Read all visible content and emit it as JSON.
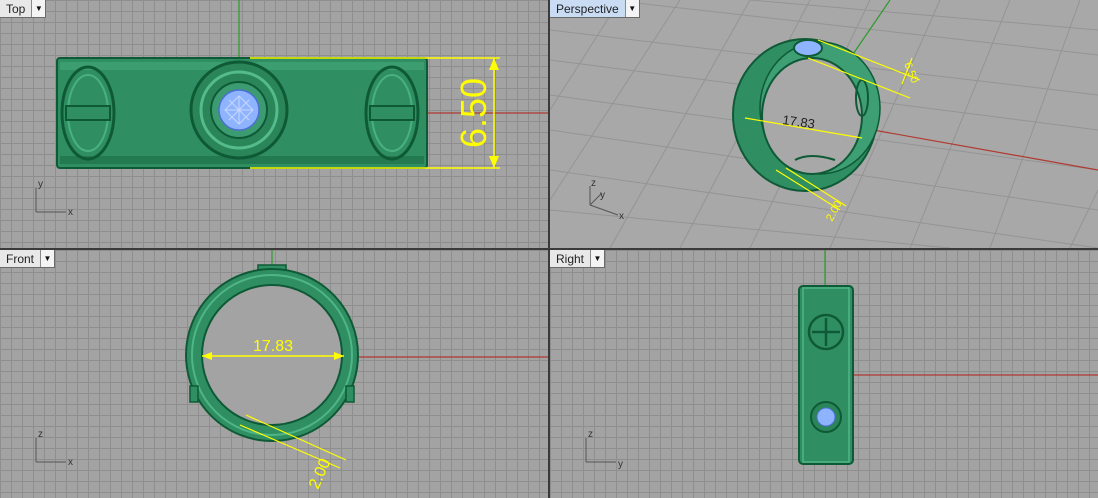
{
  "viewports": {
    "top": {
      "label": "Top",
      "axis_a": "y",
      "axis_b": "x",
      "dimension": "6.50"
    },
    "perspective": {
      "label": "Perspective",
      "axis_z": "z",
      "axis_y": "y",
      "axis_x": "x",
      "dim_width": "6.50",
      "dim_diameter": "17.83",
      "dim_thickness": "2.00"
    },
    "front": {
      "label": "Front",
      "axis_a": "z",
      "axis_b": "x",
      "dim_diameter": "17.83",
      "dim_thickness": "2.00"
    },
    "right": {
      "label": "Right",
      "axis_a": "z",
      "axis_b": "y"
    }
  },
  "icons": {
    "dropdown": "dropdown-arrow-icon"
  },
  "colors": {
    "ring": "#2f8f63",
    "ring_dark": "#0f5a36",
    "dimension": "#ffff00",
    "axis_x": "#b03a30",
    "axis_y": "#2e9a2e",
    "gem": "#8fb4ff",
    "active_tab": "#c9dcf3"
  }
}
